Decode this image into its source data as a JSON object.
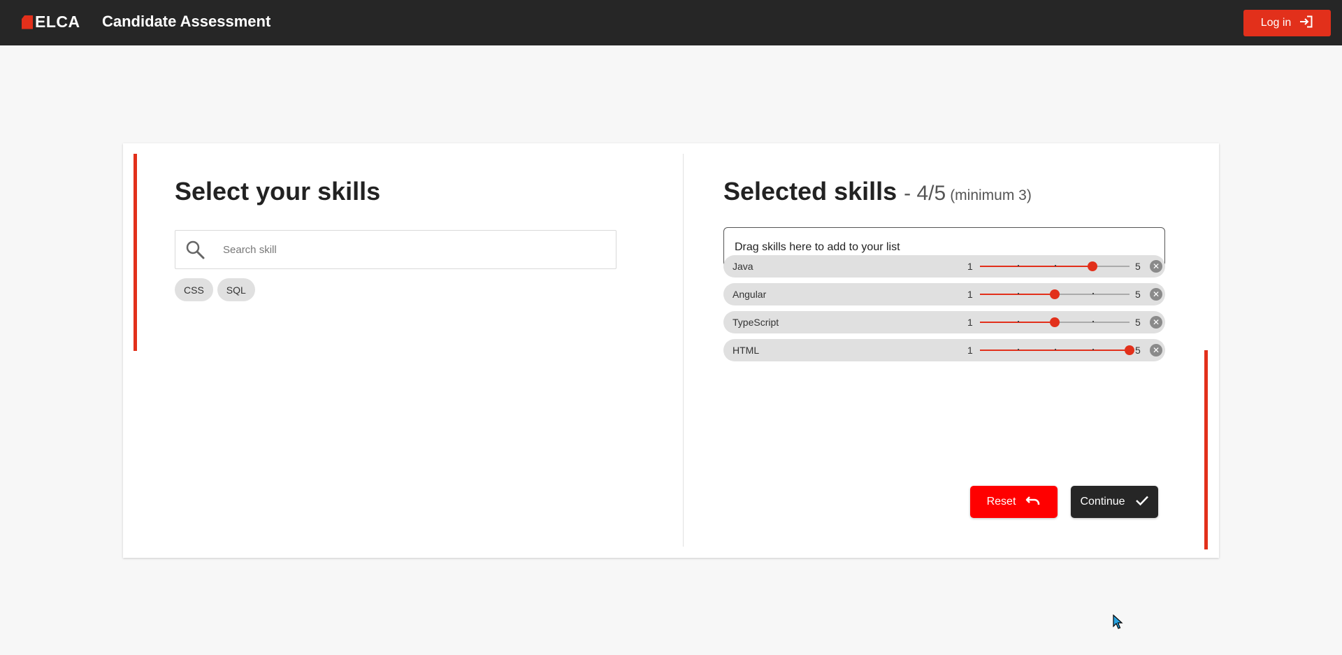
{
  "header": {
    "logo_text": "ELCA",
    "app_title": "Candidate Assessment",
    "login_label": "Log in"
  },
  "left_panel": {
    "title": "Select your skills",
    "search_placeholder": "Search skill",
    "available_skills": [
      "CSS",
      "SQL"
    ]
  },
  "right_panel": {
    "title": "Selected skills",
    "count": "- 4/5",
    "minimum": "(minimum 3)",
    "dropzone_text": "Drag skills here to add to your list",
    "skills": [
      {
        "name": "Java",
        "min_label": "1",
        "max_label": "5",
        "level": 4
      },
      {
        "name": "Angular",
        "min_label": "1",
        "max_label": "5",
        "level": 3
      },
      {
        "name": "TypeScript",
        "min_label": "1",
        "max_label": "5",
        "level": 3
      },
      {
        "name": "HTML",
        "min_label": "1",
        "max_label": "5",
        "level": 5
      }
    ],
    "scale_min": 1,
    "scale_max": 5
  },
  "actions": {
    "reset_label": "Reset",
    "continue_label": "Continue"
  },
  "colors": {
    "accent": "#e2301b",
    "reset": "#ff0000",
    "dark": "#262626"
  }
}
